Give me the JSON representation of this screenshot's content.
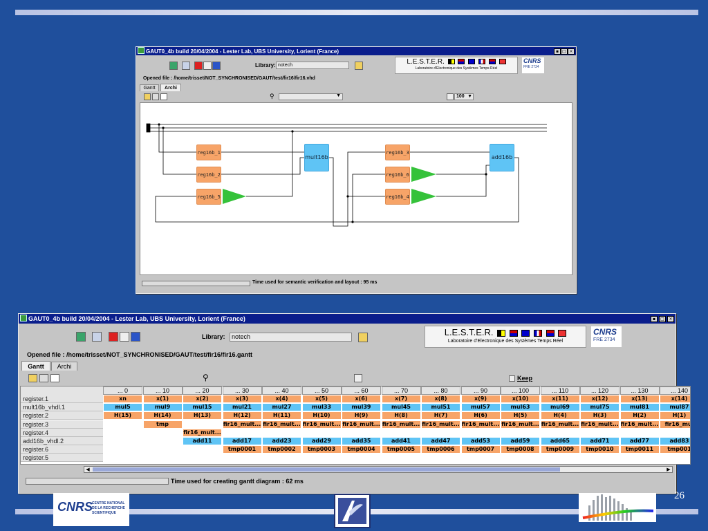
{
  "slide": {
    "page_number": "26"
  },
  "top_window": {
    "title": "GAUT0_4b build 20/04/2004 - Lester Lab, UBS University, Lorient (France)",
    "library_label": "Library:",
    "library_value": "notech",
    "lester_title": "L.E.S.T.E.R.",
    "lester_subtitle": "Laboratoire d'Electronique des Systèmes Temps Réel",
    "cnrs_code": "FRE 2734",
    "opened_file": "Opened file : /home/trisset/NOT_SYNCHRONISED/GAUT/test/fir16/fir16.vhd",
    "tabs": [
      "Gantt",
      "Archi"
    ],
    "zoom_value": "100",
    "blocks": {
      "reg1": "reg16b_1",
      "reg2": "reg16b_2",
      "reg5": "reg16b_5",
      "mult": "mult16b",
      "reg3": "reg16b_3",
      "reg6": "reg16b_6",
      "reg4": "reg16b_4",
      "add": "add16b"
    },
    "status": "Time used for semantic verification and layout : 95 ms"
  },
  "bottom_window": {
    "title": "GAUT0_4b build 20/04/2004 - Lester Lab, UBS University, Lorient (France)",
    "library_label": "Library:",
    "library_value": "notech",
    "lester_title": "L.E.S.T.E.R.",
    "lester_subtitle": "Laboratoire d'Electronique des Systèmes Temps Réel",
    "cnrs_code": "FRE 2734",
    "opened_file": "Opened file : /home/trisset/NOT_SYNCHRONISED/GAUT/test/fir16/fir16.gantt",
    "tabs": [
      "Gantt",
      "Archi"
    ],
    "keep_label": "Keep",
    "columns": [
      "... 0",
      "... 10",
      "... 20",
      "... 30",
      "... 40",
      "... 50",
      "... 60",
      "... 70",
      "... 80",
      "... 90",
      "... 100",
      "... 110",
      "... 120",
      "... 130",
      "... 140"
    ],
    "rows": [
      {
        "name": "register.1",
        "color": "orange",
        "cells": [
          "xn",
          "x(1)",
          "x(2)",
          "x(3)",
          "x(4)",
          "x(5)",
          "x(6)",
          "x(7)",
          "x(8)",
          "x(9)",
          "x(10)",
          "x(11)",
          "x(12)",
          "x(13)",
          "x(14)"
        ]
      },
      {
        "name": "mult16b_vhdl.1",
        "color": "blue",
        "cells": [
          "mul5",
          "mul9",
          "mul15",
          "mul21",
          "mul27",
          "mul33",
          "mul39",
          "mul45",
          "mul51",
          "mul57",
          "mul63",
          "mul69",
          "mul75",
          "mul81",
          "mul87"
        ]
      },
      {
        "name": "register.2",
        "color": "orange",
        "cells": [
          "H(15)",
          "H(14)",
          "H(13)",
          "H(12)",
          "H(11)",
          "H(10)",
          "H(9)",
          "H(8)",
          "H(7)",
          "H(6)",
          "H(5)",
          "H(4)",
          "H(3)",
          "H(2)",
          "H(1)"
        ]
      },
      {
        "name": "register.3",
        "color": "orange",
        "cells": [
          "",
          "tmp",
          "",
          "fir16_mult...",
          "fir16_mult...",
          "fir16_mult...",
          "fir16_mult...",
          "fir16_mult...",
          "fir16_mult...",
          "fir16_mult...",
          "fir16_mult...",
          "fir16_mult...",
          "fir16_mult...",
          "fir16_mult...",
          "fir16_mul"
        ]
      },
      {
        "name": "register.4",
        "color": "orange",
        "cells": [
          "",
          "",
          "fir16_mult...",
          "",
          "",
          "",
          "",
          "",
          "",
          "",
          "",
          "",
          "",
          "",
          ""
        ]
      },
      {
        "name": "add16b_vhdl.2",
        "color": "blue",
        "cells": [
          "",
          "",
          "add11",
          "add17",
          "add23",
          "add29",
          "add35",
          "add41",
          "add47",
          "add53",
          "add59",
          "add65",
          "add71",
          "add77",
          "add83"
        ]
      },
      {
        "name": "register.6",
        "color": "orange",
        "cells": [
          "",
          "",
          "",
          "tmp0001",
          "tmp0002",
          "tmp0003",
          "tmp0004",
          "tmp0005",
          "tmp0006",
          "tmp0007",
          "tmp0008",
          "tmp0009",
          "tmp0010",
          "tmp0011",
          "tmp001"
        ]
      },
      {
        "name": "register.5",
        "color": "orange",
        "cells": [
          "",
          "",
          "",
          "",
          "",
          "",
          "",
          "",
          "",
          "",
          "",
          "",
          "",
          "",
          ""
        ]
      }
    ],
    "status": "Time used for creating gantt diagram : 62 ms"
  },
  "footer_logo": {
    "cnrs_text": [
      "CENTRE NATIONAL",
      "DE LA RECHERCHE",
      "SCIENTIFIQUE"
    ]
  },
  "colors": {
    "background": "#1f4f9c",
    "titlebar": "#0a1e8c",
    "orange": "#f7a468",
    "blue": "#5fc4f5",
    "green": "#35c23a"
  }
}
